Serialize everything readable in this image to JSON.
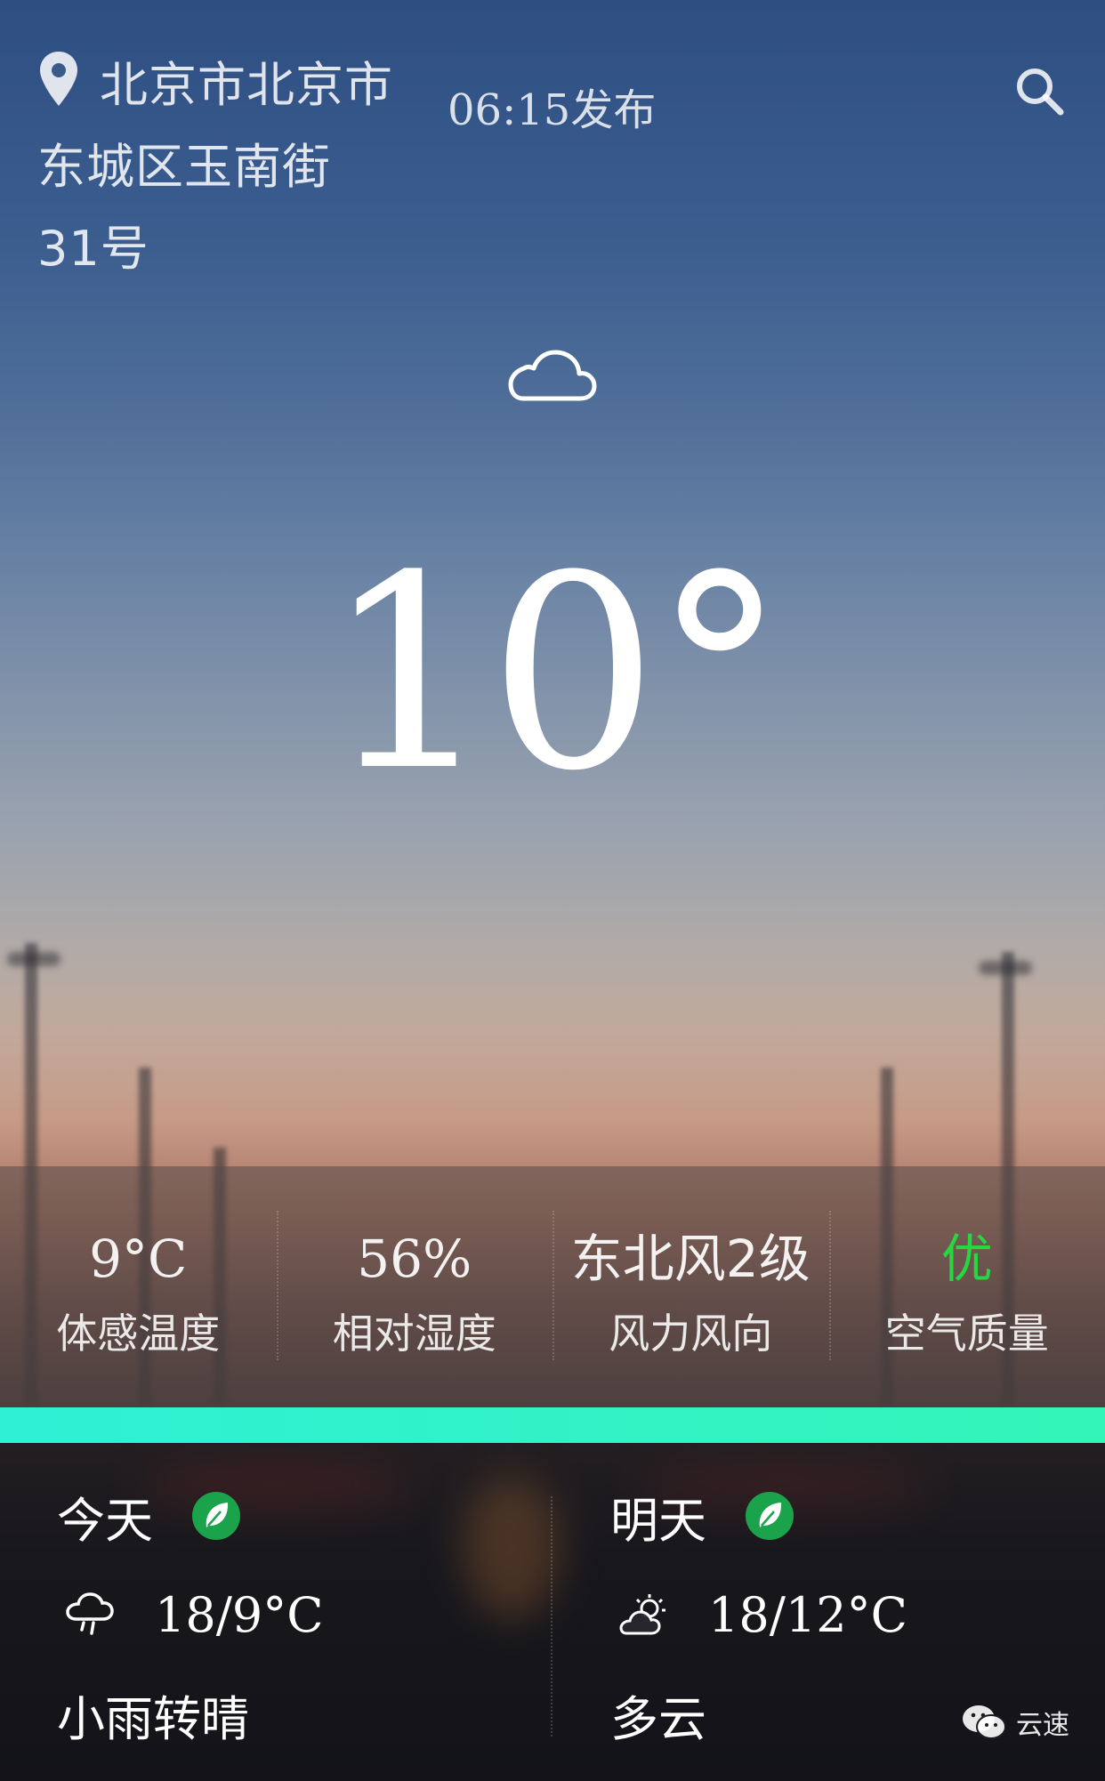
{
  "header": {
    "location": "北京市北京市东城区玉南街31号",
    "publish_time": "06:15发布",
    "icons": {
      "location": "location-pin-icon",
      "search": "search-icon"
    }
  },
  "current": {
    "condition_icon": "cloudy-icon",
    "temperature": "10°"
  },
  "stats": [
    {
      "value": "9°C",
      "label": "体感温度"
    },
    {
      "value": "56%",
      "label": "相对湿度"
    },
    {
      "value": "东北风2级",
      "label": "风力风向"
    },
    {
      "value": "优",
      "label": "空气质量",
      "value_color": "#27d641"
    }
  ],
  "forecast": [
    {
      "day": "今天",
      "air_icon": "leaf-badge-icon",
      "weather_icon": "light-rain-icon",
      "temp": "18/9°C",
      "condition": "小雨转晴"
    },
    {
      "day": "明天",
      "air_icon": "leaf-badge-icon",
      "weather_icon": "partly-cloudy-icon",
      "temp": "18/12°C",
      "condition": "多云"
    }
  ],
  "watermark": {
    "text": "云速",
    "icon": "wechat-icon"
  },
  "colors": {
    "accent_bar": "#2ff0d5",
    "aqi_good": "#27d641",
    "leaf_badge": "#1aa34a"
  }
}
